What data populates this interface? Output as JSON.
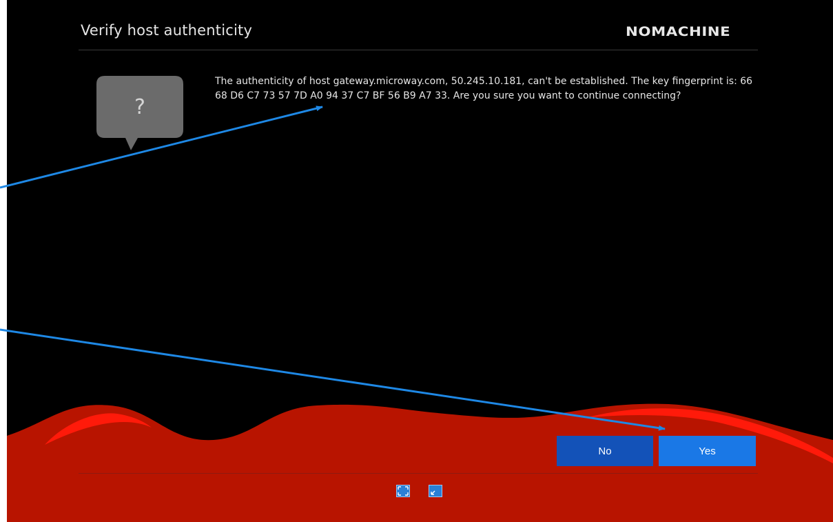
{
  "dialog": {
    "title": "Verify host authenticity",
    "brand": "NOMACHINE",
    "bubble_symbol": "?",
    "message": "The authenticity of host gateway.microway.com, 50.245.10.181, can't be established. The key fingerprint is: 66 68 D6 C7 73 57 7D A0 94 37 C7 BF 56 B9 A7 33. Are you sure you want to continue connecting?"
  },
  "buttons": {
    "no_label": "No",
    "yes_label": "Yes"
  },
  "footer": {
    "icons": [
      "fullscreen-icon",
      "window-icon"
    ]
  },
  "colors": {
    "background": "#000000",
    "wave_red": "#b81400",
    "highlight_red": "#ff1a0a",
    "button_no": "#1352b8",
    "button_yes": "#1a78e6",
    "annotation_arrow": "#1e88e5"
  }
}
